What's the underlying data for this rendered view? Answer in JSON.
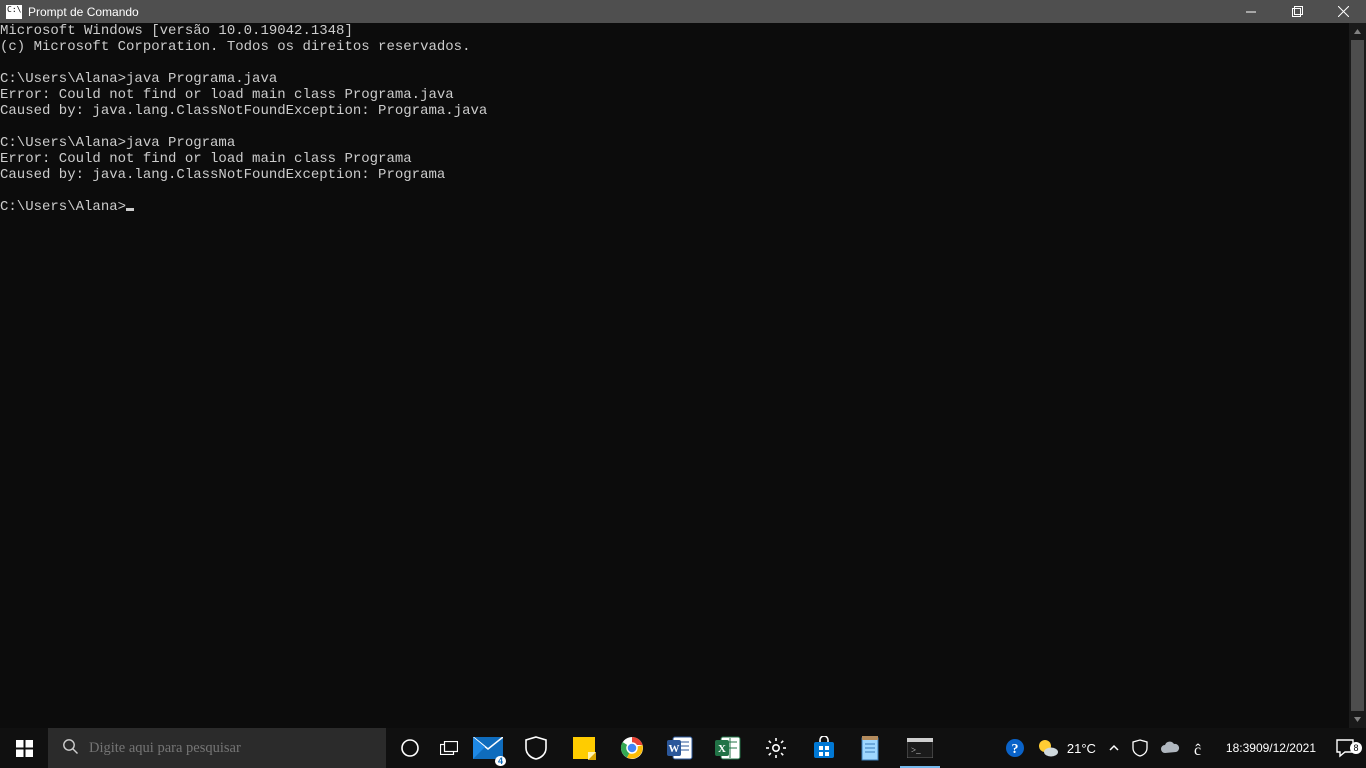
{
  "window": {
    "title": "Prompt de Comando"
  },
  "terminal": {
    "lines": [
      "Microsoft Windows [versão 10.0.19042.1348]",
      "(c) Microsoft Corporation. Todos os direitos reservados.",
      "",
      "C:\\Users\\Alana>java Programa.java",
      "Error: Could not find or load main class Programa.java",
      "Caused by: java.lang.ClassNotFoundException: Programa.java",
      "",
      "C:\\Users\\Alana>java Programa",
      "Error: Could not find or load main class Programa",
      "Caused by: java.lang.ClassNotFoundException: Programa",
      ""
    ],
    "prompt": "C:\\Users\\Alana>"
  },
  "taskbar": {
    "search_placeholder": "Digite aqui para pesquisar",
    "mail_badge": "4",
    "weather_temp": "21°C",
    "time": "18:39",
    "date": "09/12/2021",
    "notif_badge": "8"
  }
}
